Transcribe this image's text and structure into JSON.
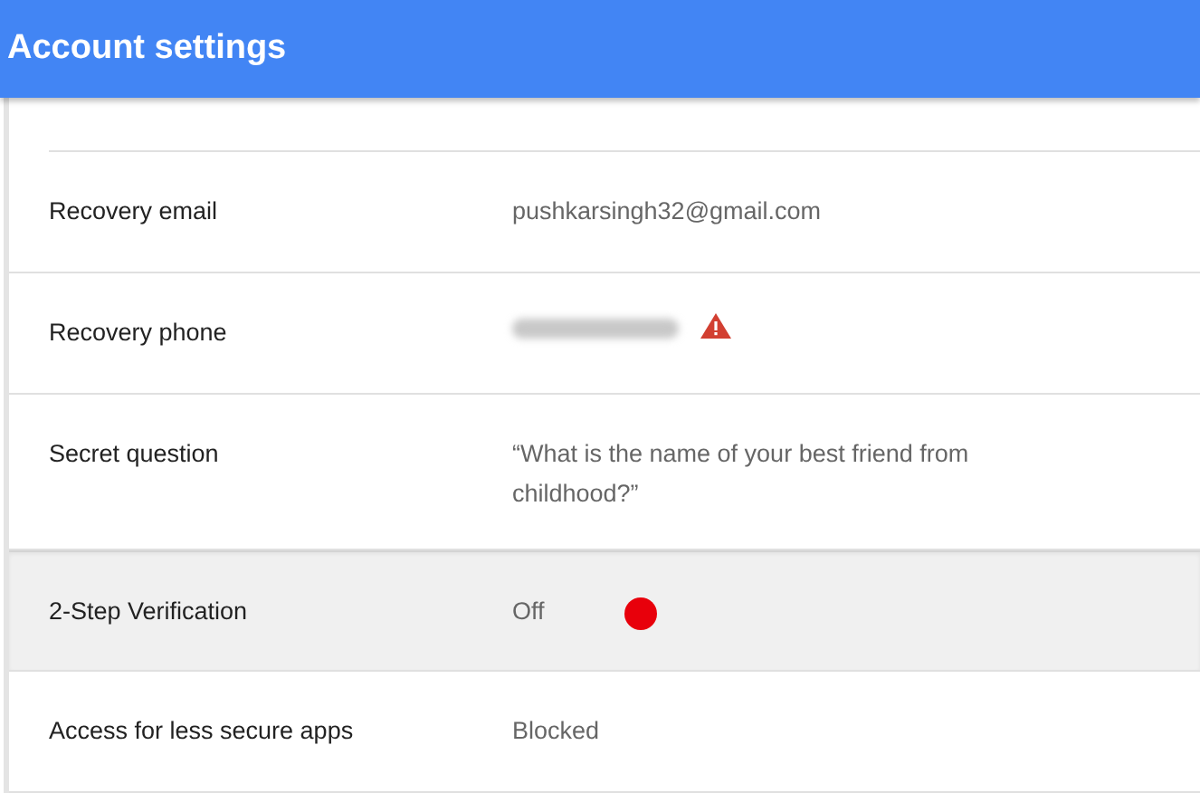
{
  "header": {
    "title": "Account settings"
  },
  "rows": [
    {
      "label": "Recovery email",
      "kind": "text",
      "value": "pushkarsingh32@gmail.com",
      "highlighted": false
    },
    {
      "label": "Recovery phone",
      "kind": "redacted",
      "warning": true,
      "highlighted": false
    },
    {
      "label": "Secret question",
      "kind": "text",
      "value": "“What is the name of your best friend from childhood?”",
      "highlighted": false
    },
    {
      "label": "2-Step Verification",
      "kind": "text",
      "value": "Off",
      "color": "#e8000b",
      "highlighted": true
    },
    {
      "label": "Access for less secure apps",
      "kind": "text",
      "value": "Blocked",
      "highlighted": false
    }
  ]
}
